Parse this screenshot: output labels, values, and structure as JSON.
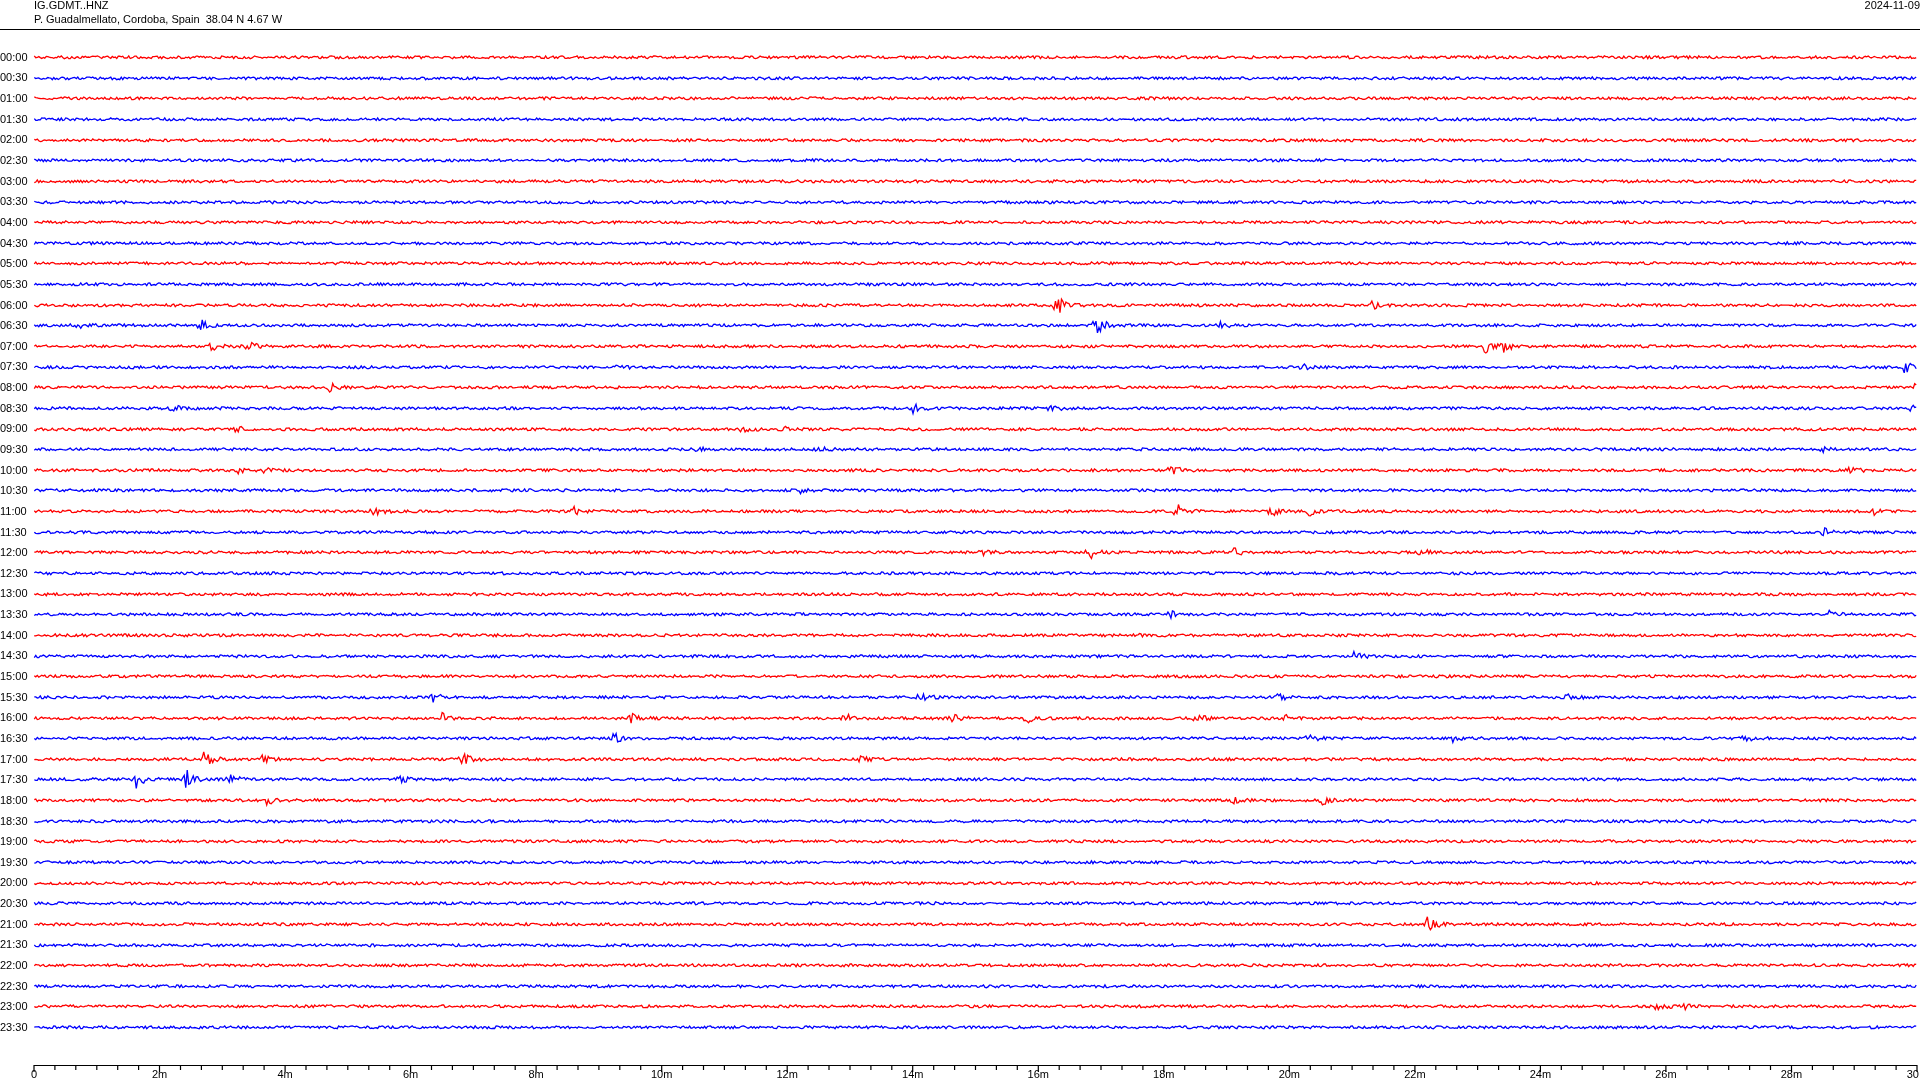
{
  "header": {
    "station": "IG.GDMT..HNZ",
    "location": "P. Guadalmellato, Cordoba, Spain  38.04 N 4.67 W",
    "date": "2024-11-09"
  },
  "traces": [
    {
      "time": "00:00",
      "color": "#ff0000"
    },
    {
      "time": "00:30",
      "color": "#0000ff"
    },
    {
      "time": "01:00",
      "color": "#ff0000"
    },
    {
      "time": "01:30",
      "color": "#0000ff"
    },
    {
      "time": "02:00",
      "color": "#ff0000"
    },
    {
      "time": "02:30",
      "color": "#0000ff"
    },
    {
      "time": "03:00",
      "color": "#ff0000"
    },
    {
      "time": "03:30",
      "color": "#0000ff"
    },
    {
      "time": "04:00",
      "color": "#ff0000"
    },
    {
      "time": "04:30",
      "color": "#0000ff"
    },
    {
      "time": "05:00",
      "color": "#ff0000"
    },
    {
      "time": "05:30",
      "color": "#0000ff"
    },
    {
      "time": "06:00",
      "color": "#ff0000"
    },
    {
      "time": "06:30",
      "color": "#0000ff"
    },
    {
      "time": "07:00",
      "color": "#ff0000"
    },
    {
      "time": "07:30",
      "color": "#0000ff"
    },
    {
      "time": "08:00",
      "color": "#ff0000"
    },
    {
      "time": "08:30",
      "color": "#0000ff"
    },
    {
      "time": "09:00",
      "color": "#ff0000"
    },
    {
      "time": "09:30",
      "color": "#0000ff"
    },
    {
      "time": "10:00",
      "color": "#ff0000"
    },
    {
      "time": "10:30",
      "color": "#0000ff"
    },
    {
      "time": "11:00",
      "color": "#ff0000"
    },
    {
      "time": "11:30",
      "color": "#0000ff"
    },
    {
      "time": "12:00",
      "color": "#ff0000"
    },
    {
      "time": "12:30",
      "color": "#0000ff"
    },
    {
      "time": "13:00",
      "color": "#ff0000"
    },
    {
      "time": "13:30",
      "color": "#0000ff"
    },
    {
      "time": "14:00",
      "color": "#ff0000"
    },
    {
      "time": "14:30",
      "color": "#0000ff"
    },
    {
      "time": "15:00",
      "color": "#ff0000"
    },
    {
      "time": "15:30",
      "color": "#0000ff"
    },
    {
      "time": "16:00",
      "color": "#ff0000"
    },
    {
      "time": "16:30",
      "color": "#0000ff"
    },
    {
      "time": "17:00",
      "color": "#ff0000"
    },
    {
      "time": "17:30",
      "color": "#0000ff"
    },
    {
      "time": "18:00",
      "color": "#ff0000"
    },
    {
      "time": "18:30",
      "color": "#0000ff"
    },
    {
      "time": "19:00",
      "color": "#ff0000"
    },
    {
      "time": "19:30",
      "color": "#0000ff"
    },
    {
      "time": "20:00",
      "color": "#ff0000"
    },
    {
      "time": "20:30",
      "color": "#0000ff"
    },
    {
      "time": "21:00",
      "color": "#ff0000"
    },
    {
      "time": "21:30",
      "color": "#0000ff"
    },
    {
      "time": "22:00",
      "color": "#ff0000"
    },
    {
      "time": "22:30",
      "color": "#0000ff"
    },
    {
      "time": "23:00",
      "color": "#ff0000"
    },
    {
      "time": "23:30",
      "color": "#0000ff"
    }
  ],
  "x_axis": {
    "tick_labels": [
      "0",
      "2m",
      "4m",
      "6m",
      "8m",
      "10m",
      "12m",
      "14m",
      "16m",
      "18m",
      "20m",
      "22m",
      "24m",
      "26m",
      "28m",
      "30"
    ]
  }
}
